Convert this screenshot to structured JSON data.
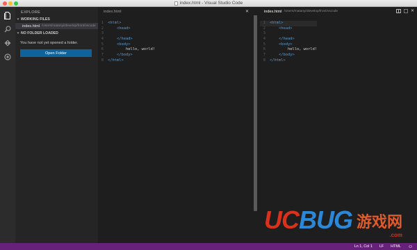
{
  "window": {
    "title": "index.html - Visual Studio Code"
  },
  "activity_bar": {
    "icons": [
      "files-icon",
      "search-icon",
      "git-icon",
      "debug-icon"
    ]
  },
  "sidebar": {
    "title": "EXPLORE",
    "working_files": {
      "header": "WORKING FILES",
      "items": [
        {
          "name": "index.html",
          "path": "/Users/matanyi/develop/front/vscode"
        }
      ]
    },
    "no_folder": {
      "header": "NO FOLDER LOADED",
      "message": "You have not yet opened a folder.",
      "button_label": "Open Folder"
    }
  },
  "editor_left": {
    "tab_name": "index.html",
    "lines": [
      {
        "n": "1",
        "text": "<html>"
      },
      {
        "n": "2",
        "text": "    <head>"
      },
      {
        "n": "3",
        "text": ""
      },
      {
        "n": "4",
        "text": "    </head>"
      },
      {
        "n": "5",
        "text": "    <body>"
      },
      {
        "n": "6",
        "text": "        hello, world!"
      },
      {
        "n": "7",
        "text": "    </body>"
      },
      {
        "n": "8",
        "text": "</html>"
      }
    ]
  },
  "editor_right": {
    "tab_name": "index.html",
    "tab_path": "/Users/matanyi/develop/front/vscode",
    "lines": [
      {
        "n": "1",
        "text": "<html>"
      },
      {
        "n": "2",
        "text": "    <head>"
      },
      {
        "n": "3",
        "text": ""
      },
      {
        "n": "4",
        "text": "    </head>"
      },
      {
        "n": "5",
        "text": "    <body>"
      },
      {
        "n": "6",
        "text": "        hello, world!"
      },
      {
        "n": "7",
        "text": "    </body>"
      },
      {
        "n": "8",
        "text": "</html>"
      }
    ]
  },
  "statusbar": {
    "position": "Ln 1, Col 1",
    "eol": "LF",
    "language": "HTML"
  },
  "watermark": {
    "brand_a": "UC",
    "brand_b": "BUG",
    "cn": "游戏网",
    "domain": ".com"
  },
  "colors": {
    "statusbar": "#68217a",
    "button": "#0e639c",
    "tag": "#569cd6"
  }
}
